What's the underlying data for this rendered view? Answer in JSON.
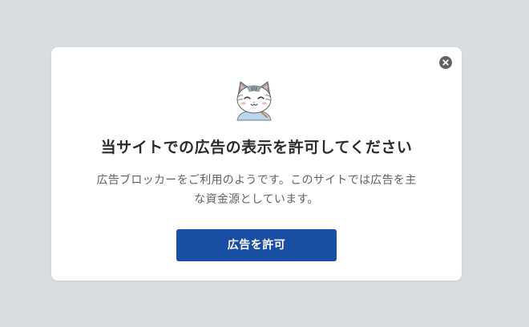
{
  "dialog": {
    "title": "当サイトでの広告の表示を許可してください",
    "message": "広告ブロッカーをご利用のようです。このサイトでは広告を主な資金源としています。",
    "allow_button_label": "広告を許可",
    "close_icon": "close-icon",
    "illustration_icon": "cat-mascot-icon"
  },
  "colors": {
    "backdrop": "#d9dde1",
    "accent": "#1a4ea4",
    "close": "#5f6368"
  }
}
